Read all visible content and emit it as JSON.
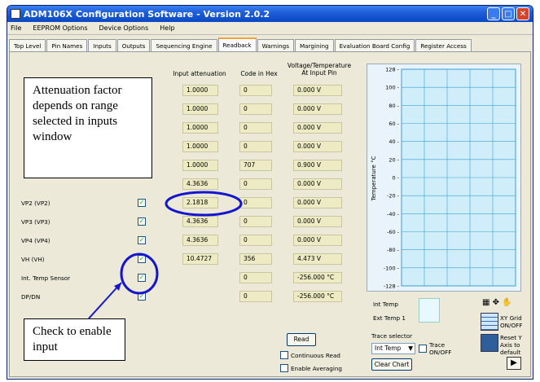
{
  "window": {
    "title": "ADM106X Configuration Software - Version 2.0.2"
  },
  "menu": [
    "File",
    "EEPROM Options",
    "Device Options",
    "Help"
  ],
  "tabs": [
    "Top Level",
    "Pin Names",
    "Inputs",
    "Outputs",
    "Sequencing Engine",
    "Readback",
    "Warnings",
    "Margining",
    "Evaluation Board Config",
    "Register Access"
  ],
  "active_tab": "Readback",
  "headers": {
    "attenuation": "Input attenuation",
    "hex": "Code in Hex",
    "voltage": "Voltage/Temperature At Input Pin"
  },
  "rows": [
    {
      "label": "",
      "checked": false,
      "attenuation": "1.0000",
      "hex": "0",
      "voltage": "0.000 V"
    },
    {
      "label": "",
      "checked": false,
      "attenuation": "1.0000",
      "hex": "0",
      "voltage": "0.000 V"
    },
    {
      "label": "",
      "checked": false,
      "attenuation": "1.0000",
      "hex": "0",
      "voltage": "0.000 V"
    },
    {
      "label": "",
      "checked": false,
      "attenuation": "1.0000",
      "hex": "0",
      "voltage": "0.000 V"
    },
    {
      "label": "",
      "checked": false,
      "attenuation": "1.0000",
      "hex": "707",
      "voltage": "0.900 V"
    },
    {
      "label": "",
      "checked": false,
      "attenuation": "4.3636",
      "hex": "0",
      "voltage": "0.000 V"
    },
    {
      "label": "VP2  (VP2)",
      "checked": true,
      "attenuation": "2.1818",
      "hex": "0",
      "voltage": "0.000 V"
    },
    {
      "label": "VP3  (VP3)",
      "checked": true,
      "attenuation": "4.3636",
      "hex": "0",
      "voltage": "0.000 V"
    },
    {
      "label": "VP4  (VP4)",
      "checked": true,
      "attenuation": "4.3636",
      "hex": "0",
      "voltage": "0.000 V"
    },
    {
      "label": "VH  (VH)",
      "checked": true,
      "attenuation": "10.4727",
      "hex": "356",
      "voltage": "4.473 V"
    },
    {
      "label": "Int. Temp Sensor",
      "checked": true,
      "attenuation": "",
      "hex": "0",
      "voltage": "-256.000 °C"
    },
    {
      "label": "DP/DN",
      "checked": true,
      "attenuation": "",
      "hex": "0",
      "voltage": "-256.000 °C"
    }
  ],
  "chart": {
    "ylabel": "Temperature °C",
    "ticks": [
      "128 -",
      "100 -",
      "80 -",
      "60 -",
      "40 -",
      "20 -",
      "0 -",
      "-20 -",
      "-40 -",
      "-60 -",
      "-80 -",
      "-100 -",
      "-128 -"
    ],
    "legend": [
      "Int Temp",
      "Ext Temp 1"
    ],
    "xy_grid_label": "XY Grid ON/OFF",
    "reset_y_label": "Reset Y Axis to default"
  },
  "chart_data": {
    "type": "line",
    "ylabel": "Temperature °C",
    "ylim": [
      -128,
      128
    ],
    "grid": true,
    "series": [
      {
        "name": "Int Temp",
        "values": []
      },
      {
        "name": "Ext Temp 1",
        "values": []
      }
    ]
  },
  "controls": {
    "read": "Read",
    "continuous": "Continuous Read",
    "averaging": "Enable Averaging",
    "trace_selector": "Trace selector",
    "trace_value": "Int Temp",
    "trace_onoff": "Trace ON/OFF",
    "clear_chart": "Clear Chart"
  },
  "callouts": {
    "attenuation": "Attenuation factor depends on range selected in inputs window",
    "enable": "Check to enable input"
  },
  "colors": {
    "accent": "#0b48c4",
    "annotation": "#1515d0",
    "valuebox": "#ecebc3"
  }
}
